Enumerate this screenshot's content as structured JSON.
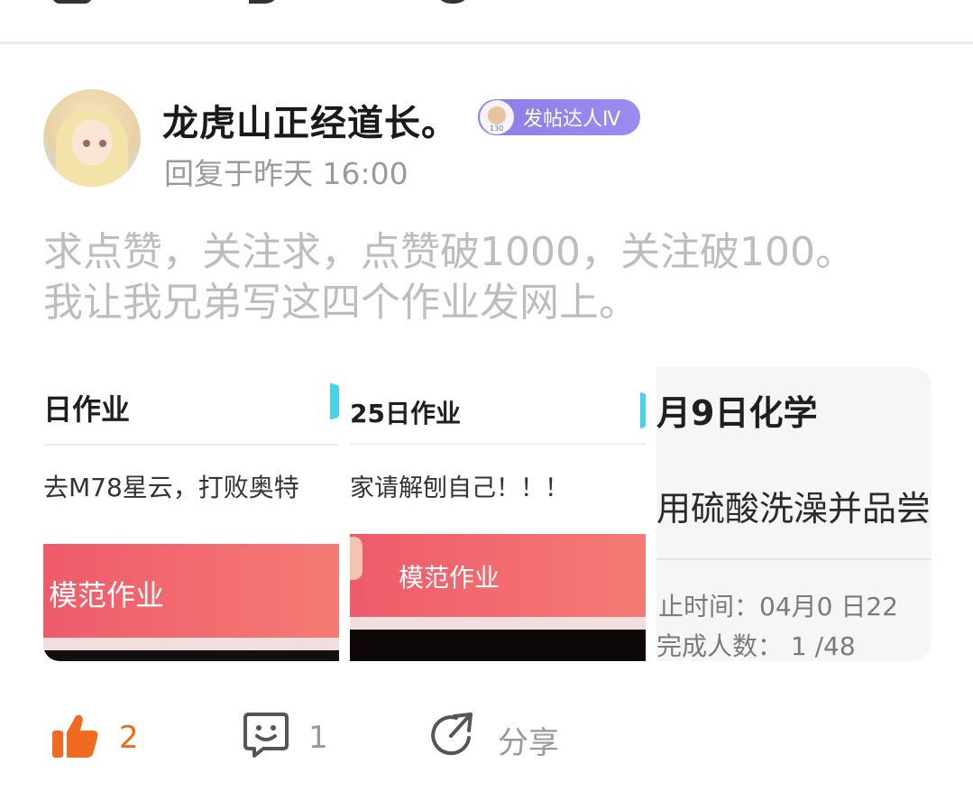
{
  "post": {
    "username": "龙虎山正经道长。",
    "badge_label": "发帖达人Ⅳ",
    "badge_level": "130",
    "reply_time": "回复于昨天 16:00",
    "text_lines": [
      "求点赞，关注求，点赞破1000，关注破100。",
      "我让我兄弟写这四个作业发网上。"
    ]
  },
  "images": [
    {
      "title": "日作业",
      "body": "去M78星云，打败奥特",
      "banner": "模范作业"
    },
    {
      "title": "25日作业",
      "body": "家请解刨自己！！！",
      "banner": "模范作业"
    },
    {
      "title": "月9日化学",
      "body": "用硫酸洗澡并品尝",
      "deadline": "止时间：04月0 日22",
      "count": "完成人数： 1 /48"
    }
  ],
  "actions": {
    "like_count": "2",
    "comment_count": "1",
    "share_label": "分享"
  },
  "colors": {
    "accent_orange": "#f06a1f",
    "badge_purple": "#8e7ce8",
    "banner_red": "#ee5b6b"
  }
}
